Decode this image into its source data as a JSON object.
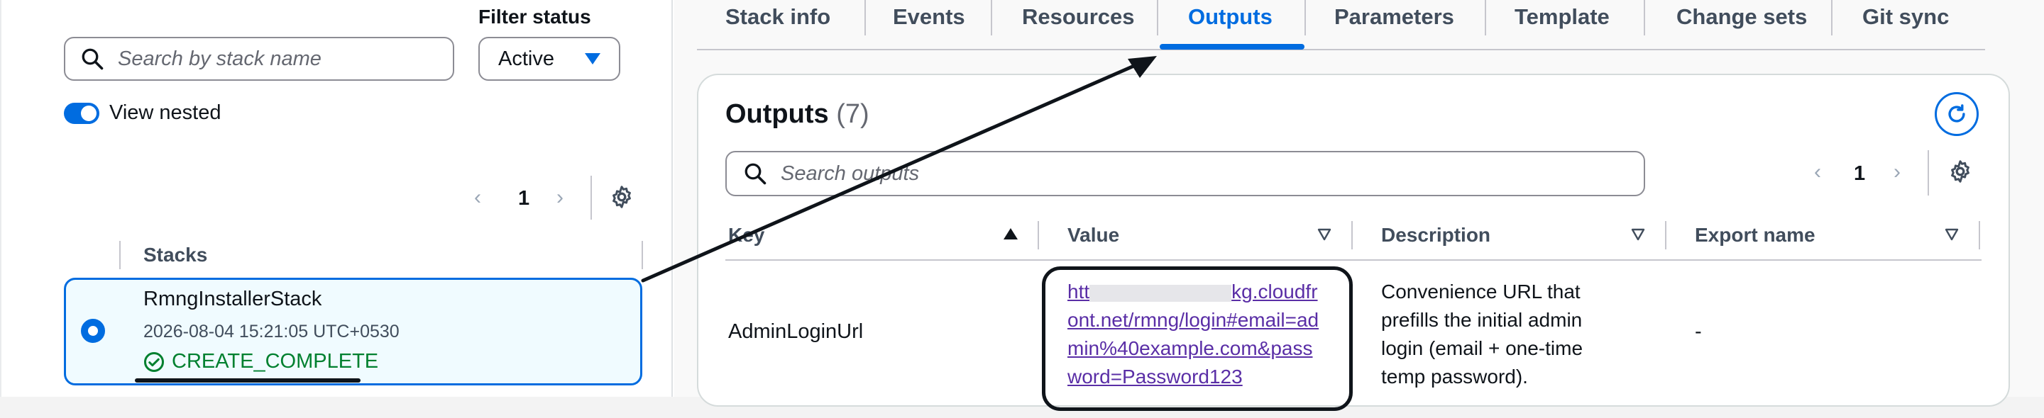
{
  "stack_list": {
    "search_placeholder": "Search by stack name",
    "filter_label": "Filter status",
    "filter_value": "Active",
    "view_nested_label": "View nested",
    "view_nested_on": true,
    "page_number": "1",
    "column_header": "Stacks",
    "selected_stack": {
      "name": "RmngInstallerStack",
      "created": "2026-08-04 15:21:05 UTC+0530",
      "status": "CREATE_COMPLETE"
    }
  },
  "tabs": [
    {
      "label": "Stack info",
      "active": false
    },
    {
      "label": "Events",
      "active": false
    },
    {
      "label": "Resources",
      "active": false
    },
    {
      "label": "Outputs",
      "active": true
    },
    {
      "label": "Parameters",
      "active": false
    },
    {
      "label": "Template",
      "active": false
    },
    {
      "label": "Change sets",
      "active": false
    },
    {
      "label": "Git sync",
      "active": false
    }
  ],
  "outputs": {
    "title": "Outputs",
    "count": "(7)",
    "search_placeholder": "Search outputs",
    "page_number": "1",
    "columns": [
      "Key",
      "Value",
      "Description",
      "Export name"
    ],
    "rows": [
      {
        "key": "AdminLoginUrl",
        "value_start": "htt",
        "value_rest": "kg.cloudfront.net/rmng/login#email=admin%40example.com&password=Password123",
        "description": "Convenience URL that prefills the initial admin login (email + one-time temp password).",
        "export_name": "-"
      }
    ]
  },
  "colors": {
    "accent": "#006ce0",
    "success": "#00802f",
    "link_visited": "#5a2ea6",
    "annotation": "#0f141a"
  }
}
